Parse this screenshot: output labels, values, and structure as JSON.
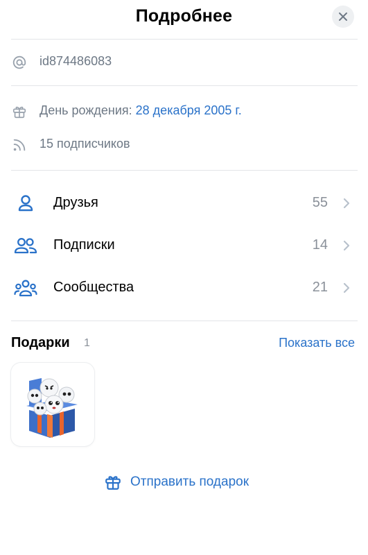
{
  "header": {
    "title": "Подробнее",
    "close_icon": "close-icon"
  },
  "info": {
    "user_id": "id874486083",
    "birthday_label": "День рождения:",
    "birthday_value": "28 декабря 2005 г.",
    "followers": "15 подписчиков"
  },
  "nav": [
    {
      "label": "Друзья",
      "count": "55",
      "icon": "user-icon"
    },
    {
      "label": "Подписки",
      "count": "14",
      "icon": "users-icon"
    },
    {
      "label": "Сообщества",
      "count": "21",
      "icon": "community-icon"
    }
  ],
  "gifts": {
    "title": "Подарки",
    "count": "1",
    "show_all": "Показать все",
    "send_label": "Отправить подарок"
  },
  "colors": {
    "accent": "#2a72c9",
    "secondary_text": "#6d7885",
    "divider": "#e3e5e8"
  }
}
